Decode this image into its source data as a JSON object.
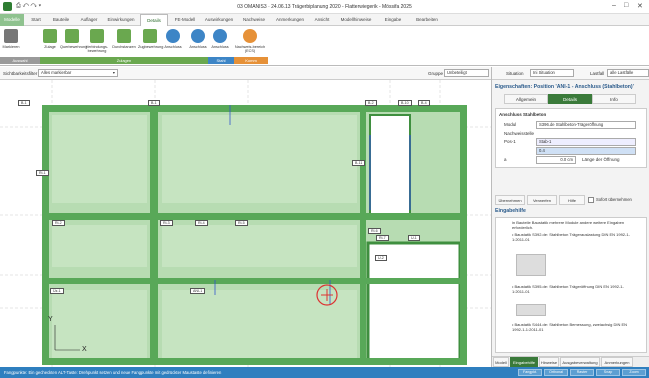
{
  "window": {
    "title": "03 OMANIS3 · 24.06.13 Trägerbiplanung 2020 - Flatterwiegerik - Mössifa 2025"
  },
  "ribbon_tabs": [
    {
      "label": "Modelle",
      "mod": true
    },
    {
      "label": "Start"
    },
    {
      "label": "Bauteile"
    },
    {
      "label": "Auflager"
    },
    {
      "label": "Einwirkungen"
    },
    {
      "label": "Details",
      "active": true
    },
    {
      "label": "FE-Modell"
    },
    {
      "label": "Auswirkungen"
    },
    {
      "label": "Nachweise"
    },
    {
      "label": "Anmerkungen"
    },
    {
      "label": "Ansicht"
    },
    {
      "label": "Modellhinweise"
    },
    {
      "label": "Eingabe"
    },
    {
      "label": "Bearbeiten"
    }
  ],
  "ribbon_buttons": [
    {
      "label": "Markieren",
      "icon": "cursor-icon"
    },
    {
      "label": "Zulage"
    },
    {
      "label": "Querbewehrung"
    },
    {
      "label": "Verbindungs-bewehrung"
    },
    {
      "label": "Durchstanzen"
    },
    {
      "label": "Zugbewehrung"
    },
    {
      "label": "Anschluss"
    },
    {
      "label": "Anschluss"
    },
    {
      "label": "Anschluss"
    },
    {
      "label": "Nachweis-bereich (ECS)"
    }
  ],
  "ribbon_groups": [
    "Auswahl",
    "Zulagen",
    "Stahl",
    "Komm"
  ],
  "filter": {
    "label": "Sichtbarkeitsfilter",
    "value": "Alles markierbar",
    "group_label": "Gruppe",
    "group_value": "Unbeteiligt",
    "situation_label": "Situation",
    "situation_value": "Ini Situation",
    "loadcase_label": "Lastfall",
    "loadcase_value": "alle Lastfälle"
  },
  "plan_labels": [
    "B-1",
    "B-1",
    "B-2",
    "B-10",
    "B-4",
    "B-11",
    "Ri-1",
    "Ri-2",
    "Ri-3",
    "Ri-4",
    "Ri-5",
    "Ri-6",
    "Ri-7",
    "U-1",
    "U-2",
    "Üz-1",
    "ANI-1"
  ],
  "props": {
    "title": "Eigenschaften: Position 'ANI-1 - Anschluss (Stahlbeton)'",
    "tabs": [
      "Allgemein",
      "Details",
      "Info"
    ],
    "section": "Anschluss Stahlbeton",
    "rows": [
      {
        "k": "Modul",
        "v": "S396.de Stahlbeton-Trägeröffnung"
      },
      {
        "k": "Nachweisstelle",
        "v": ""
      },
      {
        "k": "Pos-1",
        "v": "Stab-1"
      },
      {
        "k": "",
        "v": "0.4"
      },
      {
        "k": "a",
        "v": "0.0 cm",
        "note": "Länge der Öffnung"
      }
    ],
    "buttons": [
      "Übernehmen",
      "Verwerfen",
      "Hilfe"
    ],
    "check": "Sofort übernehmen"
  },
  "help": {
    "title": "Eingabehilfe",
    "paras": [
      "in Bauteile Baustatik mehrere Module andere weitere Eingaben erforderlich.",
      "• Baustatik S392.de: Stahlbeton Trägerauslastung DIN EN 1992-1-1:2011-01",
      "• Baustatik S395.de: Stahlbeton Trägeröffnung DIN EN 1992-1-1:2011-01",
      "• Baustatik S444.de: Stahlbeton Bemessung, zweiachsig DIN EN 1992-1-1:2011-01"
    ]
  },
  "bottom_tabs": [
    "Modell",
    "Eingabehilfe",
    "Hinweise",
    "Ausgabeverwaltung",
    "Anmerkungen"
  ],
  "status": {
    "text": "Fangpunkte: Ein gecheckten ALT-Taste: Drehpunkt setzen und neue Fangpunkte mit gedrückter Maustaste definieren",
    "buttons": [
      "Fangpkt.",
      "Orthonal",
      "Raster",
      "Snap",
      "Zoom"
    ]
  },
  "axes": {
    "y": "Y",
    "x": "X"
  }
}
